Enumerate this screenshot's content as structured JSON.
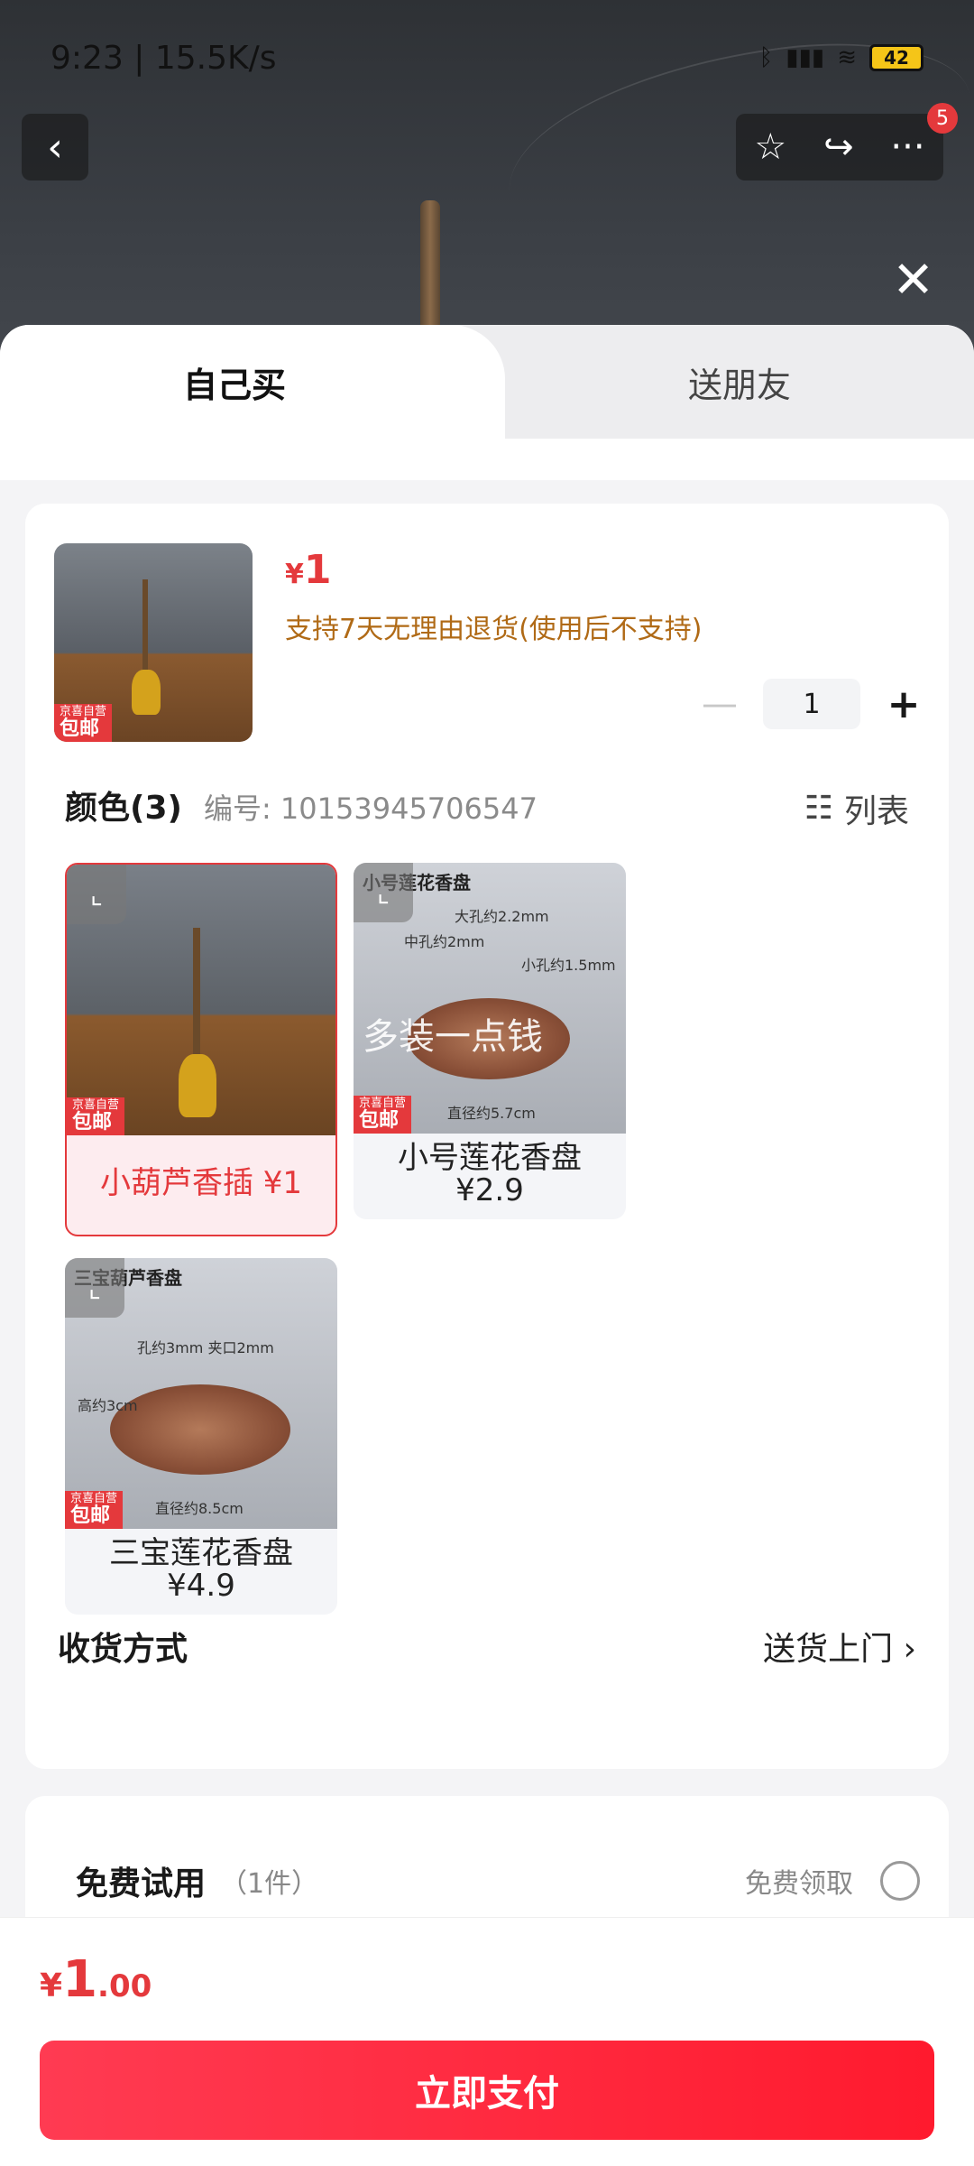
{
  "status_bar": {
    "time_speed": "9:23 | 15.5K/s",
    "battery": "42"
  },
  "header": {
    "badge_count": "5"
  },
  "tabs": {
    "self": "自己买",
    "friend": "送朋友"
  },
  "product": {
    "jd_tag_small": "京喜自营",
    "jd_tag_big": "包邮",
    "currency": "¥",
    "price": "1",
    "return_note": "支持7天无理由退货(使用后不支持)",
    "quantity": "1"
  },
  "color_section": {
    "title": "颜色(3)",
    "sku": "编号: 10153945706547",
    "list_label": "列表"
  },
  "variants": [
    {
      "label": "小葫芦香插 ¥1",
      "selected": true
    },
    {
      "caption": "小号莲花香盘",
      "overlay": "多装一点钱",
      "label": "小号莲花香盘",
      "price": "¥2.9",
      "notes": [
        "大孔约2.2mm",
        "中孔约2mm",
        "小孔约1.5mm",
        "直径约5.7cm"
      ]
    },
    {
      "caption": "三宝葫芦香盘",
      "label": "三宝莲花香盘",
      "price": "¥4.9",
      "notes": [
        "孔约3mm 夹口2mm",
        "高约3cm",
        "直径约8.5cm"
      ]
    }
  ],
  "shipping": {
    "title": "收货方式",
    "value": "送货上门"
  },
  "trial": {
    "title": "免费试用",
    "count": "（1件）",
    "get": "免费领取"
  },
  "footer": {
    "currency": "¥",
    "total_int": "1",
    "total_dec": ".00",
    "pay_label": "立即支付"
  },
  "colors": {
    "accent": "#e4393c",
    "return_note": "#b06a16"
  }
}
